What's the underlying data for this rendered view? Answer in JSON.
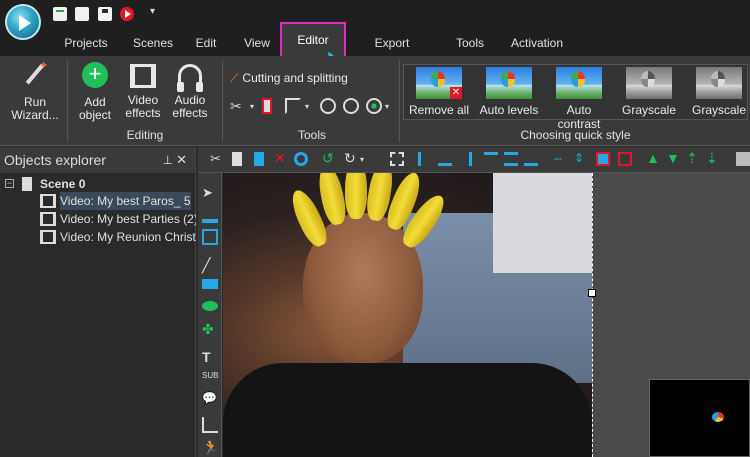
{
  "menu_tabs": [
    "Projects",
    "Scenes",
    "Edit",
    "View",
    "Editor",
    "Export project",
    "Tools",
    "Activation"
  ],
  "active_tab": "Editor",
  "ribbon": {
    "run_wizard": "Run Wizard...",
    "add_object": "Add object",
    "video_effects": "Video effects",
    "audio_effects": "Audio effects",
    "editing_group": "Editing",
    "cutting": "Cutting and splitting",
    "tools_group": "Tools",
    "styles_group": "Choosing quick style",
    "styles": [
      "Remove all",
      "Auto levels",
      "Auto contrast",
      "Grayscale",
      "Grayscale"
    ]
  },
  "explorer": {
    "title": "Objects explorer",
    "scene": "Scene 0",
    "items": [
      "Video: My best Paros_ 5",
      "Video: My best Parties (2)_",
      "Video: My Reunion Christ"
    ]
  },
  "colors": {
    "accent": "#e52ac4",
    "cursor": "#27b9e6",
    "green": "#1fbf5a",
    "red": "#e0172a"
  }
}
